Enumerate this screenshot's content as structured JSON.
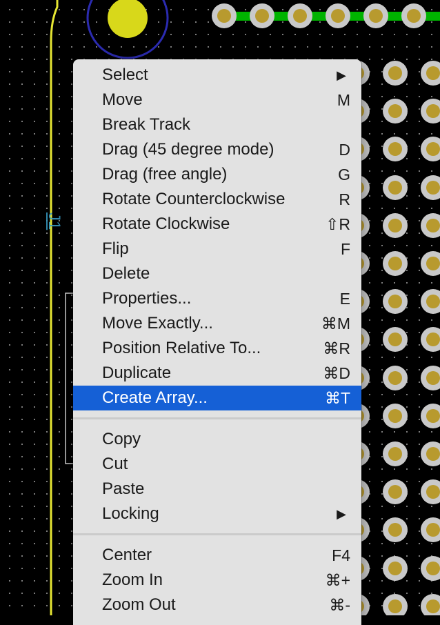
{
  "colors": {
    "board_background": "#000000",
    "pad_copper": "#b89a2e",
    "pad_ring": "#c9c9c9",
    "track": "#00b300",
    "board_outline": "#e6e633",
    "via_fill": "#d8d81a",
    "via_ring": "#2b2bb0",
    "menu_background": "#e2e2e2",
    "menu_highlight": "#1560d6"
  },
  "canvas": {
    "reference_label": "J1"
  },
  "context_menu": {
    "groups": [
      [
        {
          "label": "Select",
          "shortcut": "",
          "submenu": true,
          "arrow": "▶",
          "name": "menu-item-select"
        },
        {
          "label": "Move",
          "shortcut": "M",
          "name": "menu-item-move"
        },
        {
          "label": "Break Track",
          "shortcut": "",
          "name": "menu-item-break-track"
        },
        {
          "label": "Drag (45 degree mode)",
          "shortcut": "D",
          "name": "menu-item-drag-45"
        },
        {
          "label": "Drag (free angle)",
          "shortcut": "G",
          "name": "menu-item-drag-free-angle"
        },
        {
          "label": "Rotate Counterclockwise",
          "shortcut": "R",
          "name": "menu-item-rotate-ccw"
        },
        {
          "label": "Rotate Clockwise",
          "shortcut": "⇧R",
          "name": "menu-item-rotate-cw"
        },
        {
          "label": "Flip",
          "shortcut": "F",
          "name": "menu-item-flip"
        },
        {
          "label": "Delete",
          "shortcut": "",
          "name": "menu-item-delete"
        },
        {
          "label": "Properties...",
          "shortcut": "E",
          "name": "menu-item-properties"
        },
        {
          "label": "Move Exactly...",
          "shortcut": "⌘M",
          "name": "menu-item-move-exactly"
        },
        {
          "label": "Position Relative To...",
          "shortcut": "⌘R",
          "name": "menu-item-position-relative"
        },
        {
          "label": "Duplicate",
          "shortcut": "⌘D",
          "name": "menu-item-duplicate"
        },
        {
          "label": "Create Array...",
          "shortcut": "⌘T",
          "highlighted": true,
          "name": "menu-item-create-array"
        }
      ],
      [
        {
          "label": "Copy",
          "shortcut": "",
          "name": "menu-item-copy"
        },
        {
          "label": "Cut",
          "shortcut": "",
          "name": "menu-item-cut"
        },
        {
          "label": "Paste",
          "shortcut": "",
          "name": "menu-item-paste"
        },
        {
          "label": "Locking",
          "shortcut": "",
          "submenu": true,
          "arrow": "▶",
          "name": "menu-item-locking"
        }
      ],
      [
        {
          "label": "Center",
          "shortcut": "F4",
          "name": "menu-item-center"
        },
        {
          "label": "Zoom In",
          "shortcut": "⌘+",
          "name": "menu-item-zoom-in"
        },
        {
          "label": "Zoom Out",
          "shortcut": "⌘-",
          "name": "menu-item-zoom-out"
        }
      ]
    ]
  }
}
